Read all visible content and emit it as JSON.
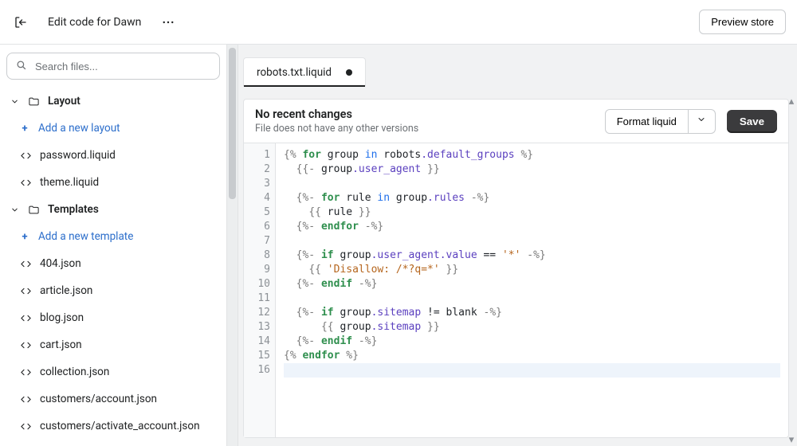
{
  "topbar": {
    "title": "Edit code for Dawn",
    "preview_label": "Preview store"
  },
  "search": {
    "placeholder": "Search files..."
  },
  "sidebar": {
    "sections": [
      {
        "name": "layout",
        "label": "Layout",
        "expanded": true,
        "add_label": "Add a new layout",
        "files": [
          "password.liquid",
          "theme.liquid"
        ]
      },
      {
        "name": "templates",
        "label": "Templates",
        "expanded": true,
        "add_label": "Add a new template",
        "files": [
          "404.json",
          "article.json",
          "blog.json",
          "cart.json",
          "collection.json",
          "customers/account.json",
          "customers/activate_account.json"
        ]
      }
    ]
  },
  "editor": {
    "tab_label": "robots.txt.liquid",
    "dirty": true,
    "status_title": "No recent changes",
    "status_sub": "File does not have any other versions",
    "format_label": "Format liquid",
    "save_label": "Save",
    "line_numbers": [
      "1",
      "2",
      "3",
      "4",
      "5",
      "6",
      "7",
      "8",
      "9",
      "10",
      "11",
      "12",
      "13",
      "14",
      "15",
      "16"
    ],
    "code_lines": [
      {
        "indent": 0,
        "type": "tag",
        "parts": [
          [
            "del",
            "{% "
          ],
          [
            "kw",
            "for"
          ],
          [
            "txt",
            " group "
          ],
          [
            "kw2",
            "in"
          ],
          [
            "txt",
            " robots"
          ],
          [
            "prop",
            ".default_groups"
          ],
          [
            "del",
            " %}"
          ]
        ]
      },
      {
        "indent": 1,
        "type": "out",
        "parts": [
          [
            "out",
            "{{- "
          ],
          [
            "txt",
            "group"
          ],
          [
            "prop",
            ".user_agent"
          ],
          [
            "out",
            " }}"
          ]
        ]
      },
      {
        "indent": 0,
        "type": "blank",
        "parts": []
      },
      {
        "indent": 1,
        "type": "tag",
        "parts": [
          [
            "del",
            "{%- "
          ],
          [
            "kw",
            "for"
          ],
          [
            "txt",
            " rule "
          ],
          [
            "kw2",
            "in"
          ],
          [
            "txt",
            " group"
          ],
          [
            "prop",
            ".rules"
          ],
          [
            "del",
            " -%}"
          ]
        ]
      },
      {
        "indent": 2,
        "type": "out",
        "parts": [
          [
            "out",
            "{{ "
          ],
          [
            "txt",
            "rule"
          ],
          [
            "out",
            " }}"
          ]
        ]
      },
      {
        "indent": 1,
        "type": "tag",
        "parts": [
          [
            "del",
            "{%- "
          ],
          [
            "kw",
            "endfor"
          ],
          [
            "del",
            " -%}"
          ]
        ]
      },
      {
        "indent": 0,
        "type": "blank",
        "parts": []
      },
      {
        "indent": 1,
        "type": "tag",
        "parts": [
          [
            "del",
            "{%- "
          ],
          [
            "kw",
            "if"
          ],
          [
            "txt",
            " group"
          ],
          [
            "prop",
            ".user_agent"
          ],
          [
            "prop",
            ".value"
          ],
          [
            "txt",
            " == "
          ],
          [
            "str",
            "'*'"
          ],
          [
            "del",
            " -%}"
          ]
        ]
      },
      {
        "indent": 2,
        "type": "out",
        "parts": [
          [
            "out",
            "{{ "
          ],
          [
            "str",
            "'Disallow: /*?q=*'"
          ],
          [
            "out",
            " }}"
          ]
        ]
      },
      {
        "indent": 1,
        "type": "tag",
        "parts": [
          [
            "del",
            "{%- "
          ],
          [
            "kw",
            "endif"
          ],
          [
            "del",
            " -%}"
          ]
        ]
      },
      {
        "indent": 0,
        "type": "blank",
        "parts": []
      },
      {
        "indent": 1,
        "type": "tag",
        "parts": [
          [
            "del",
            "{%- "
          ],
          [
            "kw",
            "if"
          ],
          [
            "txt",
            " group"
          ],
          [
            "prop",
            ".sitemap"
          ],
          [
            "txt",
            " != blank "
          ],
          [
            "del",
            "-%}"
          ]
        ]
      },
      {
        "indent": 3,
        "type": "out",
        "parts": [
          [
            "out",
            "{{ "
          ],
          [
            "txt",
            "group"
          ],
          [
            "prop",
            ".sitemap"
          ],
          [
            "out",
            " }}"
          ]
        ]
      },
      {
        "indent": 1,
        "type": "tag",
        "parts": [
          [
            "del",
            "{%- "
          ],
          [
            "kw",
            "endif"
          ],
          [
            "del",
            " -%}"
          ]
        ]
      },
      {
        "indent": 0,
        "type": "tag",
        "parts": [
          [
            "del",
            "{% "
          ],
          [
            "kw",
            "endfor"
          ],
          [
            "del",
            " %}"
          ]
        ]
      },
      {
        "indent": 0,
        "type": "current",
        "parts": []
      }
    ]
  }
}
